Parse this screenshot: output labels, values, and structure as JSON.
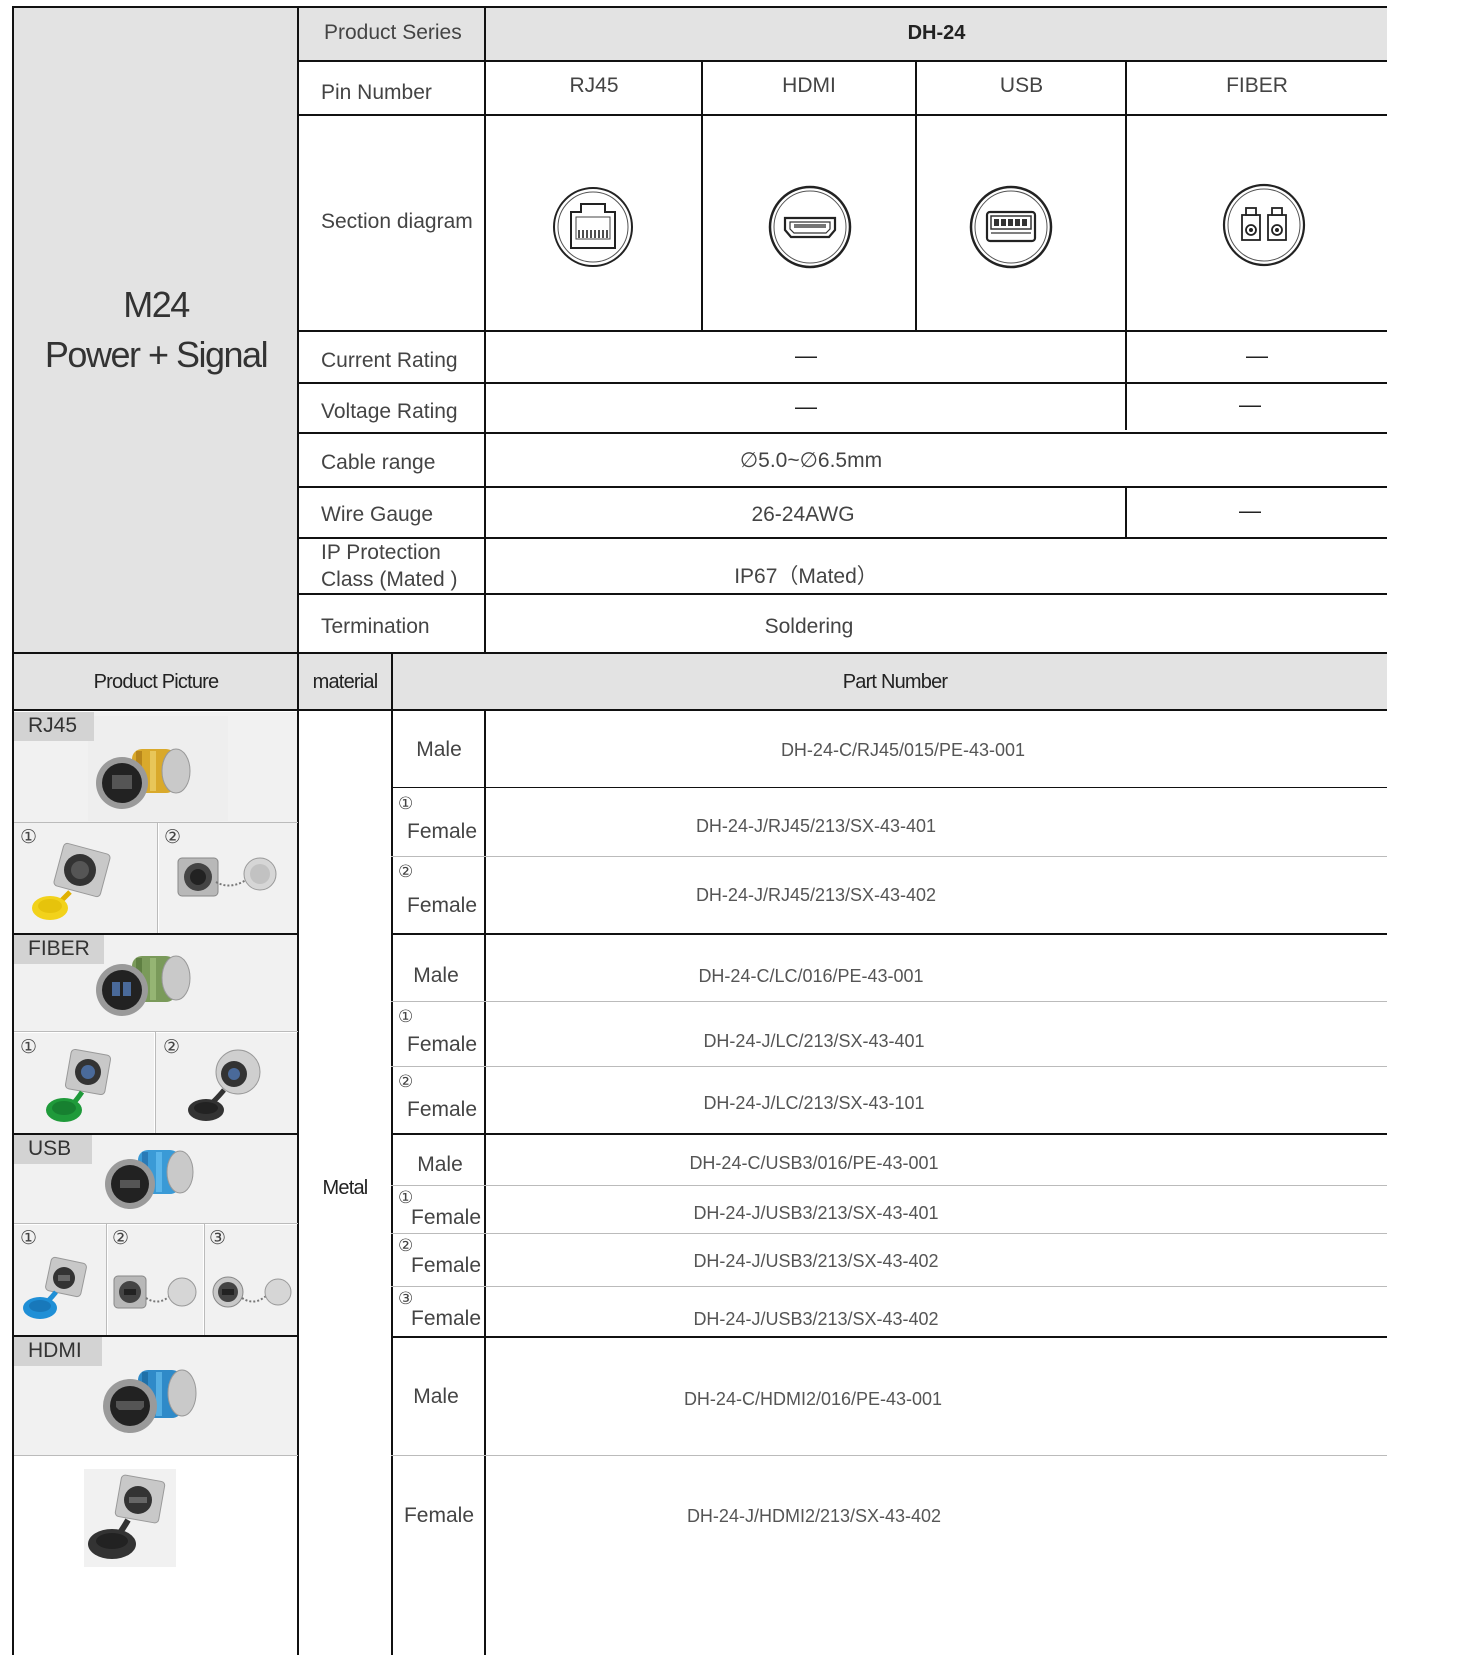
{
  "title": {
    "line1": "M24",
    "line2": "Power + Signal"
  },
  "specs": {
    "series_label": "Product Series",
    "series_value": "DH-24",
    "pin_label": "Pin Number",
    "pins": [
      "RJ45",
      "HDMI",
      "USB",
      "FIBER"
    ],
    "section_label": "Section diagram",
    "section_icons": [
      "rj45-socket-icon",
      "hdmi-socket-icon",
      "usb-socket-icon",
      "fiber-lc-socket-icon"
    ],
    "current_label": "Current Rating",
    "current_values": [
      "—",
      "—"
    ],
    "voltage_label": "Voltage Rating",
    "voltage_values": [
      "—",
      "—"
    ],
    "cable_label": "Cable range",
    "cable_value": "∅5.0~∅6.5mm",
    "wire_label": "Wire Gauge",
    "wire_values": [
      "26-24AWG",
      "—"
    ],
    "ip_label_1": "IP Protection",
    "ip_label_2": "Class (Mated )",
    "ip_value": "IP67（Mated）",
    "term_label": "Termination",
    "term_value": "Soldering"
  },
  "parts": {
    "header_picture": "Product Picture",
    "header_material": "material",
    "header_part": "Part Number",
    "material": "Metal",
    "picture_tags": [
      "RJ45",
      "FIBER",
      "USB",
      "HDMI"
    ],
    "circled": [
      "①",
      "②",
      "③"
    ],
    "rows": [
      {
        "num": "",
        "gender": "Male",
        "part": "DH-24-C/RJ45/015/PE-43-001"
      },
      {
        "num": "①",
        "gender": "Female",
        "part": "DH-24-J/RJ45/213/SX-43-401"
      },
      {
        "num": "②",
        "gender": "Female",
        "part": "DH-24-J/RJ45/213/SX-43-402"
      },
      {
        "num": "",
        "gender": "Male",
        "part": "DH-24-C/LC/016/PE-43-001"
      },
      {
        "num": "①",
        "gender": "Female",
        "part": "DH-24-J/LC/213/SX-43-401"
      },
      {
        "num": "②",
        "gender": "Female",
        "part": "DH-24-J/LC/213/SX-43-101"
      },
      {
        "num": "",
        "gender": "Male",
        "part": "DH-24-C/USB3/016/PE-43-001"
      },
      {
        "num": "①",
        "gender": "Female",
        "part": "DH-24-J/USB3/213/SX-43-401"
      },
      {
        "num": "②",
        "gender": "Female",
        "part": "DH-24-J/USB3/213/SX-43-402"
      },
      {
        "num": "③",
        "gender": "Female",
        "part": "DH-24-J/USB3/213/SX-43-402"
      },
      {
        "num": "",
        "gender": "Male",
        "part": "DH-24-C/HDMI2/016/PE-43-001"
      },
      {
        "num": "",
        "gender": "Female",
        "part": "DH-24-J/HDMI2/213/SX-43-402"
      }
    ]
  },
  "colors": {
    "gray": "#e3e3e3",
    "line": "#111111",
    "cap_yellow": "#f2d21b",
    "cap_green": "#1f9a3a",
    "cap_blue": "#1f8fd6",
    "cap_black": "#333333"
  }
}
